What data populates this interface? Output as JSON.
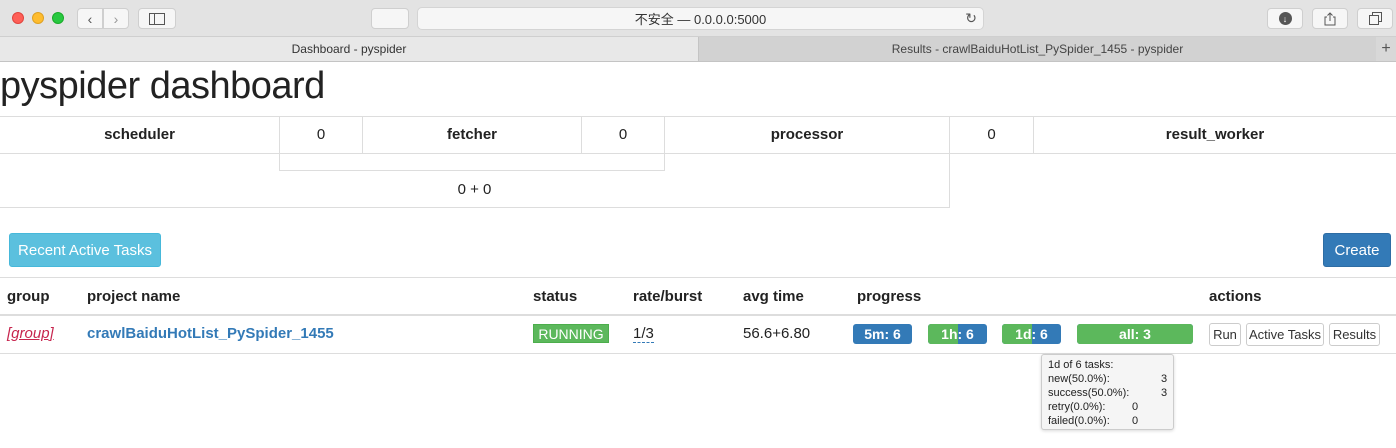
{
  "browser": {
    "url_text": "不安全 — 0.0.0.0:5000",
    "tabs": [
      {
        "label": "Dashboard - pyspider"
      },
      {
        "label": "Results - crawlBaiduHotList_PySpider_1455 - pyspider"
      }
    ],
    "new_tab_label": "+"
  },
  "page": {
    "title": "pyspider dashboard"
  },
  "stats": {
    "scheduler": {
      "label": "scheduler",
      "value": "0"
    },
    "fetcher": {
      "label": "fetcher",
      "value": "0"
    },
    "processor": {
      "label": "processor",
      "value": "0"
    },
    "result_worker": {
      "label": "result_worker"
    },
    "queue_sum": "0 + 0"
  },
  "buttons": {
    "recent_active_tasks": "Recent Active Tasks",
    "create": "Create"
  },
  "table": {
    "headers": {
      "group": "group",
      "project_name": "project name",
      "status": "status",
      "rate_burst": "rate/burst",
      "avg_time": "avg time",
      "progress": "progress",
      "actions": "actions"
    },
    "rows": [
      {
        "group": "[group]",
        "project_name": "crawlBaiduHotList_PySpider_1455",
        "status": "RUNNING",
        "rate_burst": "1/3",
        "avg_time": "56.6+6.80",
        "progress": {
          "p5m": {
            "label": "5m: 6",
            "success_fraction": 0
          },
          "p1h": {
            "label": "1h: 6",
            "success_fraction": 0.5
          },
          "p1d": {
            "label": "1d: 6",
            "success_fraction": 0.5
          },
          "all": {
            "label": "all: 3",
            "success_fraction": 1.0
          }
        },
        "actions": {
          "run": "Run",
          "active_tasks": "Active Tasks",
          "results": "Results"
        }
      }
    ]
  },
  "tooltip": {
    "title": "1d of 6 tasks:",
    "rows": [
      {
        "label": "new(50.0%):",
        "value": "3"
      },
      {
        "label": "success(50.0%):",
        "value": "3"
      },
      {
        "label": "retry(0.0%):",
        "value": "0"
      },
      {
        "label": "failed(0.0%):",
        "value": "0"
      }
    ]
  },
  "colors": {
    "info": "#5bc0de",
    "primary": "#337ab7",
    "success": "#5cb85c",
    "group_link": "#c7254e"
  }
}
